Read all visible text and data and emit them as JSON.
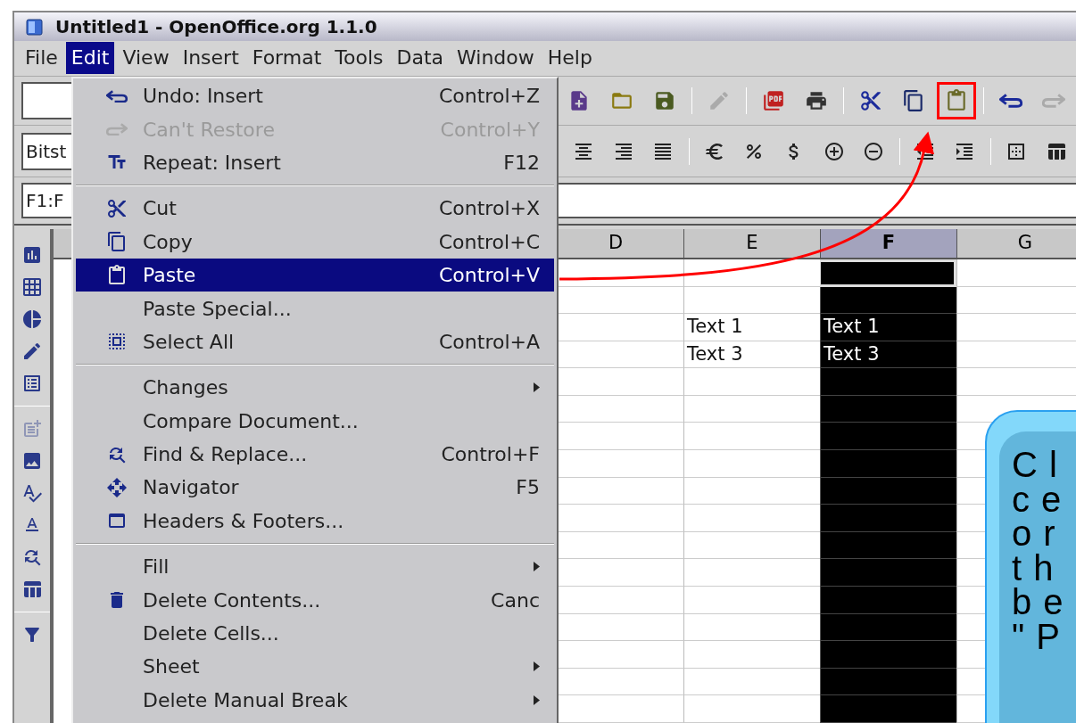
{
  "window": {
    "title": "Untitled1 - OpenOffice.org 1.1.0"
  },
  "menubar": [
    {
      "label": "File",
      "selected": false
    },
    {
      "label": "Edit",
      "selected": true
    },
    {
      "label": "View",
      "selected": false
    },
    {
      "label": "Insert",
      "selected": false
    },
    {
      "label": "Format",
      "selected": false
    },
    {
      "label": "Tools",
      "selected": false
    },
    {
      "label": "Data",
      "selected": false
    },
    {
      "label": "Window",
      "selected": false
    },
    {
      "label": "Help",
      "selected": false
    }
  ],
  "standard_toolbar": {
    "buttons": [
      {
        "highlighted": false,
        "disabled": false
      },
      {
        "highlighted": false,
        "disabled": false
      },
      {
        "highlighted": false,
        "disabled": false
      },
      {
        "highlighted": false,
        "disabled": true
      },
      {
        "highlighted": false,
        "disabled": false
      },
      {
        "highlighted": false,
        "disabled": false
      },
      {
        "highlighted": false,
        "disabled": false
      },
      {
        "highlighted": false,
        "disabled": false
      },
      {
        "highlighted": true,
        "disabled": false
      },
      {
        "highlighted": false,
        "disabled": false
      },
      {
        "highlighted": false,
        "disabled": true
      }
    ]
  },
  "formatting_toolbar": {
    "font_name": "Bitst"
  },
  "formula_bar": {
    "name_box": "F1:F"
  },
  "sheet": {
    "columns": [
      {
        "label": "D",
        "selected": false
      },
      {
        "label": "E",
        "selected": false
      },
      {
        "label": "F",
        "selected": true
      },
      {
        "label": "G",
        "selected": false
      }
    ],
    "rows": [
      {
        "cursor": true,
        "cells": [
          null,
          null,
          null,
          null
        ]
      },
      {
        "cursor": false,
        "cells": [
          null,
          null,
          null,
          null
        ]
      },
      {
        "cursor": false,
        "cells": [
          null,
          "Text 1",
          "Text 1",
          null
        ]
      },
      {
        "cursor": false,
        "cells": [
          null,
          "Text 3",
          "Text 3",
          null
        ]
      }
    ]
  },
  "edit_menu": [
    {
      "kind": "item",
      "label": "Undo: Insert",
      "shortcut": "Control+Z",
      "disabled": false,
      "selected": false
    },
    {
      "kind": "item",
      "label": "Can't Restore",
      "shortcut": "Control+Y",
      "disabled": true,
      "selected": false
    },
    {
      "kind": "item",
      "label": "Repeat: Insert",
      "shortcut": "F12",
      "disabled": false,
      "selected": false
    },
    {
      "kind": "separator"
    },
    {
      "kind": "item",
      "label": "Cut",
      "shortcut": "Control+X",
      "disabled": false,
      "selected": false
    },
    {
      "kind": "item",
      "label": "Copy",
      "shortcut": "Control+C",
      "disabled": false,
      "selected": false
    },
    {
      "kind": "item",
      "label": "Paste",
      "shortcut": "Control+V",
      "disabled": false,
      "selected": true
    },
    {
      "kind": "item",
      "label": "Paste Special...",
      "disabled": false,
      "selected": false
    },
    {
      "kind": "item",
      "label": "Select All",
      "shortcut": "Control+A",
      "disabled": false,
      "selected": false
    },
    {
      "kind": "separator"
    },
    {
      "kind": "submenu",
      "label": "Changes",
      "disabled": false,
      "selected": false
    },
    {
      "kind": "item",
      "label": "Compare Document...",
      "disabled": false,
      "selected": false
    },
    {
      "kind": "item",
      "label": "Find & Replace...",
      "shortcut": "Control+F",
      "disabled": false,
      "selected": false
    },
    {
      "kind": "item",
      "label": "Navigator",
      "shortcut": "F5",
      "disabled": false,
      "selected": false
    },
    {
      "kind": "item",
      "label": "Headers & Footers...",
      "disabled": false,
      "selected": false
    },
    {
      "kind": "separator"
    },
    {
      "kind": "submenu",
      "label": "Fill",
      "disabled": false,
      "selected": false
    },
    {
      "kind": "item",
      "label": "Delete Contents...",
      "shortcut": "Canc",
      "disabled": false,
      "selected": false
    },
    {
      "kind": "item",
      "label": "Delete Cells...",
      "disabled": false,
      "selected": false
    },
    {
      "kind": "submenu",
      "label": "Sheet",
      "disabled": false,
      "selected": false
    },
    {
      "kind": "submenu",
      "label": "Delete Manual Break",
      "disabled": false,
      "selected": false
    }
  ],
  "callout": {
    "lines": [
      "C l",
      "c e",
      "o r",
      "t h",
      "b e",
      "\" P"
    ]
  }
}
